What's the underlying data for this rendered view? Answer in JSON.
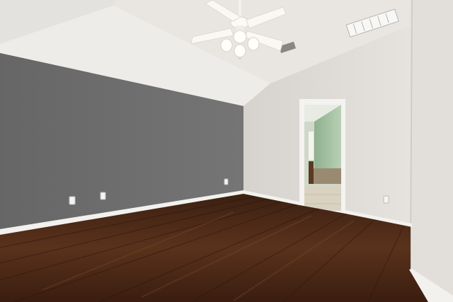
{
  "scene": {
    "subject": "empty-room-interior",
    "colors": {
      "accent_wall": "#6f6e6e",
      "ceiling": "#eeece8",
      "side_wall": "#dedbd7",
      "floor": "#4e2c1a",
      "baseboard": "#f2f1ee",
      "bathroom_wall": "#a8c4a6"
    },
    "objects": [
      {
        "name": "ceiling-fan",
        "icon": "ceiling-fan-icon"
      },
      {
        "name": "air-vent",
        "icon": "vent-icon"
      },
      {
        "name": "doorway",
        "icon": "door-icon"
      },
      {
        "name": "electrical-outlet",
        "icon": "outlet-icon"
      },
      {
        "name": "hardwood-floor",
        "icon": "floor-icon"
      }
    ]
  }
}
